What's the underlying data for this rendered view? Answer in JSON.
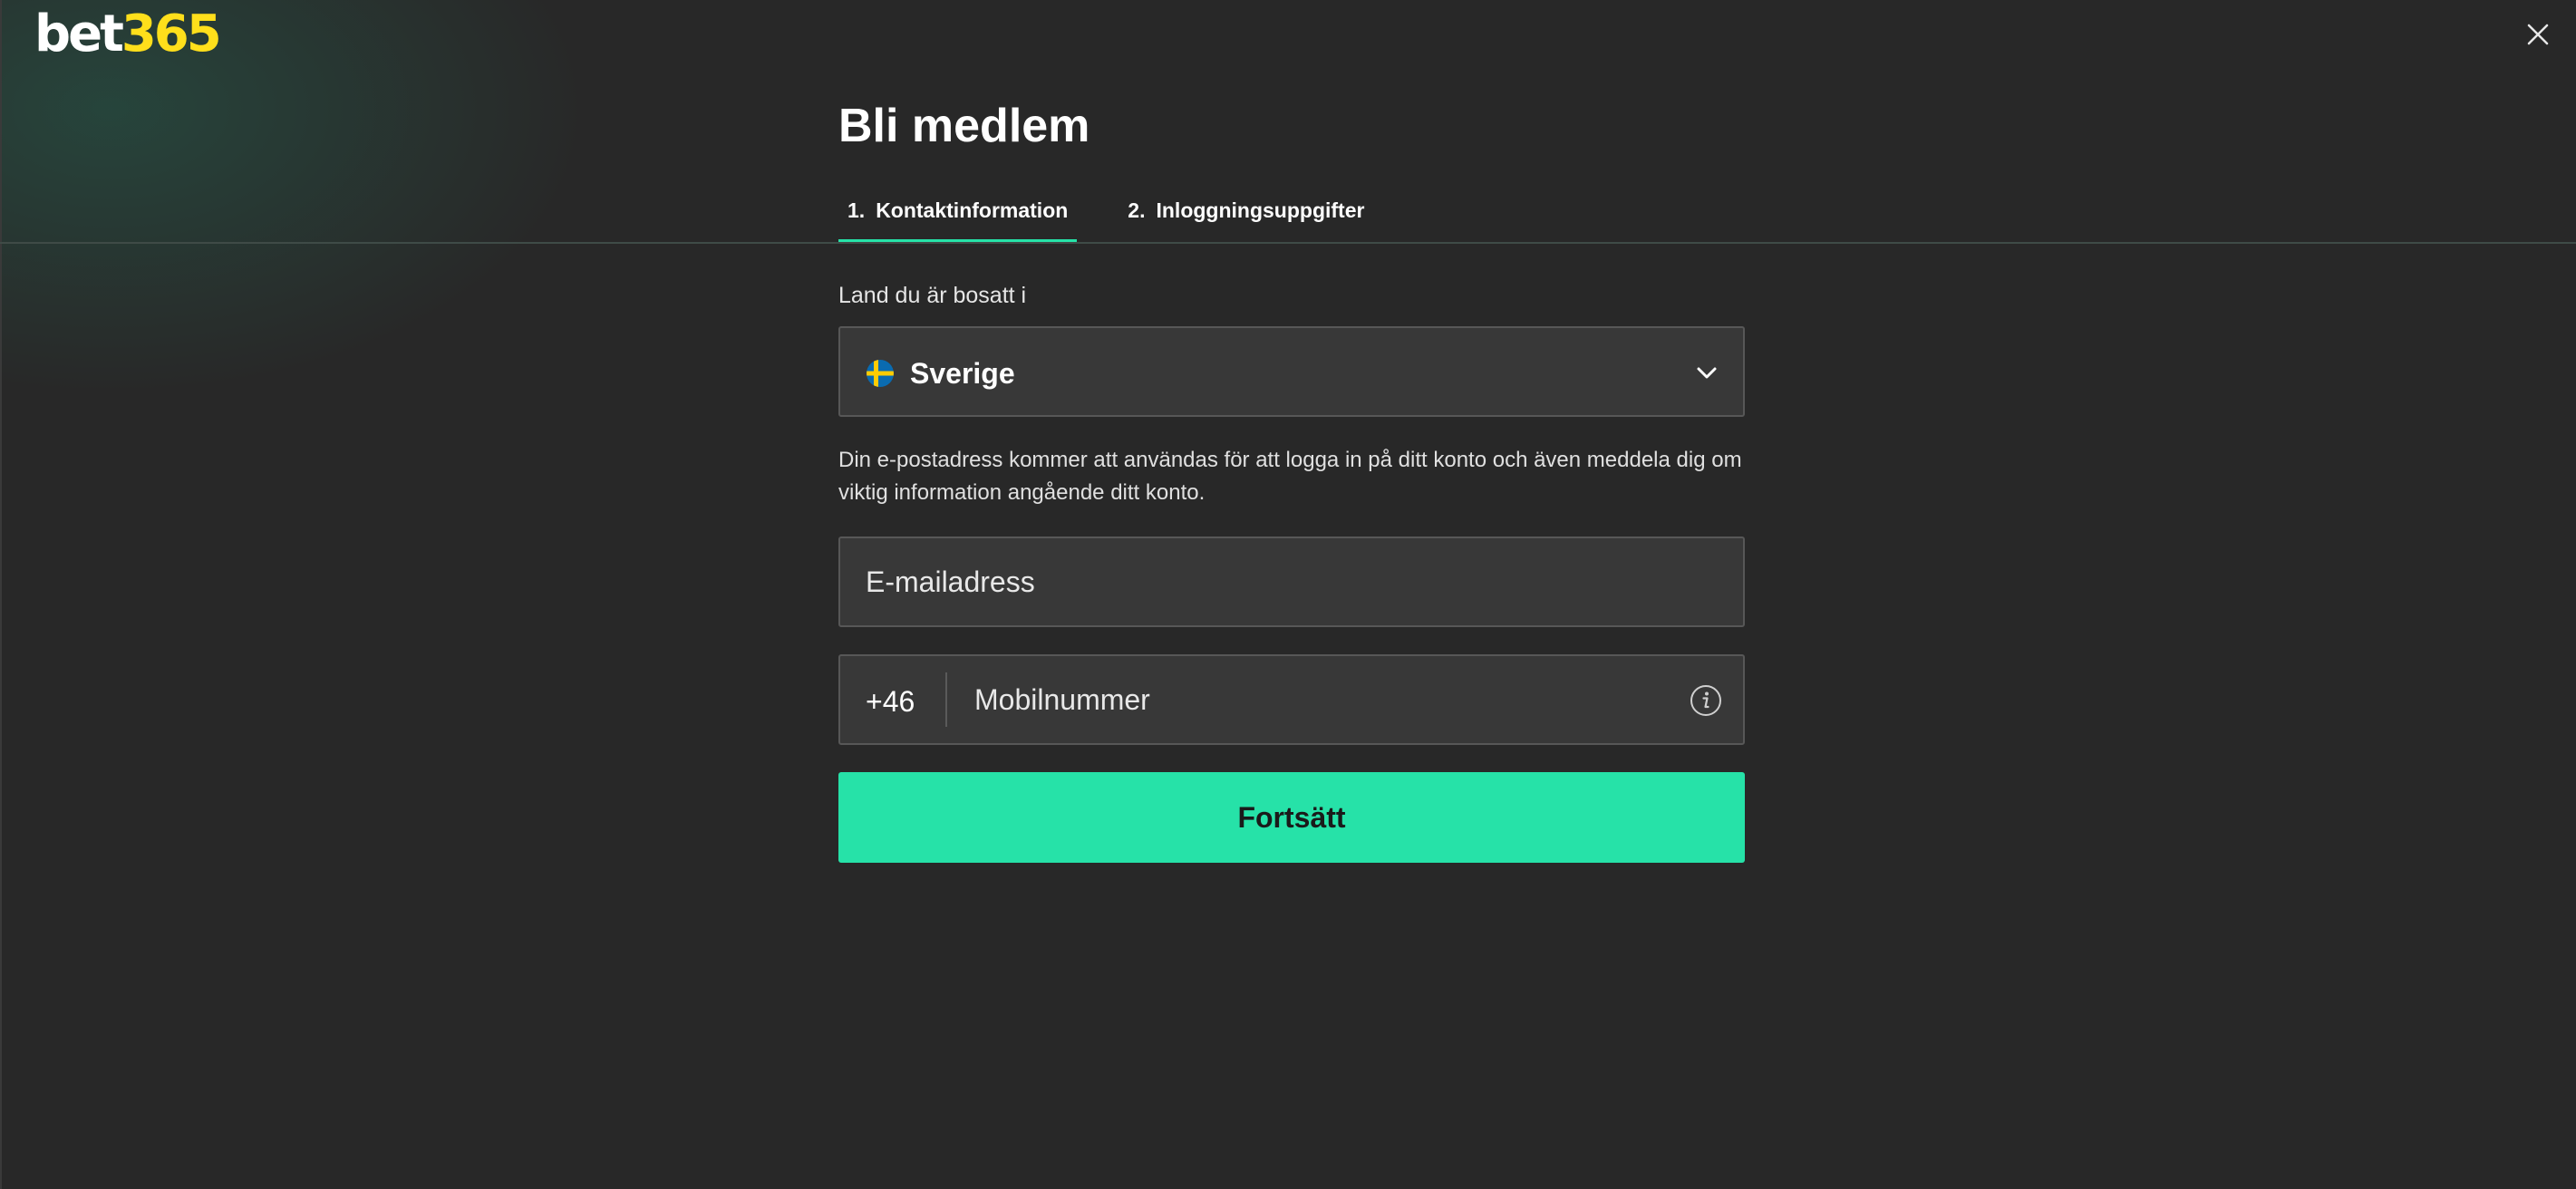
{
  "brand": {
    "logo_part1": "bet",
    "logo_part2": "365",
    "colors": {
      "logo_white": "#ffffff",
      "logo_yellow": "#ffdf1b",
      "accent": "#26e2a8",
      "background": "#282828",
      "field_background": "#383838"
    }
  },
  "header": {
    "close_icon": "close-icon"
  },
  "page": {
    "title": "Bli medlem"
  },
  "tabs": [
    {
      "number": "1.",
      "label": "Kontaktinformation",
      "active": true
    },
    {
      "number": "2.",
      "label": "Inloggningsuppgifter",
      "active": false
    }
  ],
  "form": {
    "country_label": "Land du är bosatt i",
    "country": {
      "value": "Sverige",
      "flag_icon": "sweden-flag-icon",
      "dropdown_icon": "chevron-down-icon"
    },
    "email_info": "Din e-postadress kommer att användas för att logga in på ditt konto och även meddela dig om viktig information angående ditt konto.",
    "email": {
      "placeholder": "E-mailadress",
      "value": ""
    },
    "phone": {
      "prefix": "+46",
      "placeholder": "Mobilnummer",
      "value": "",
      "info_icon": "info-icon"
    },
    "continue_label": "Fortsätt"
  }
}
